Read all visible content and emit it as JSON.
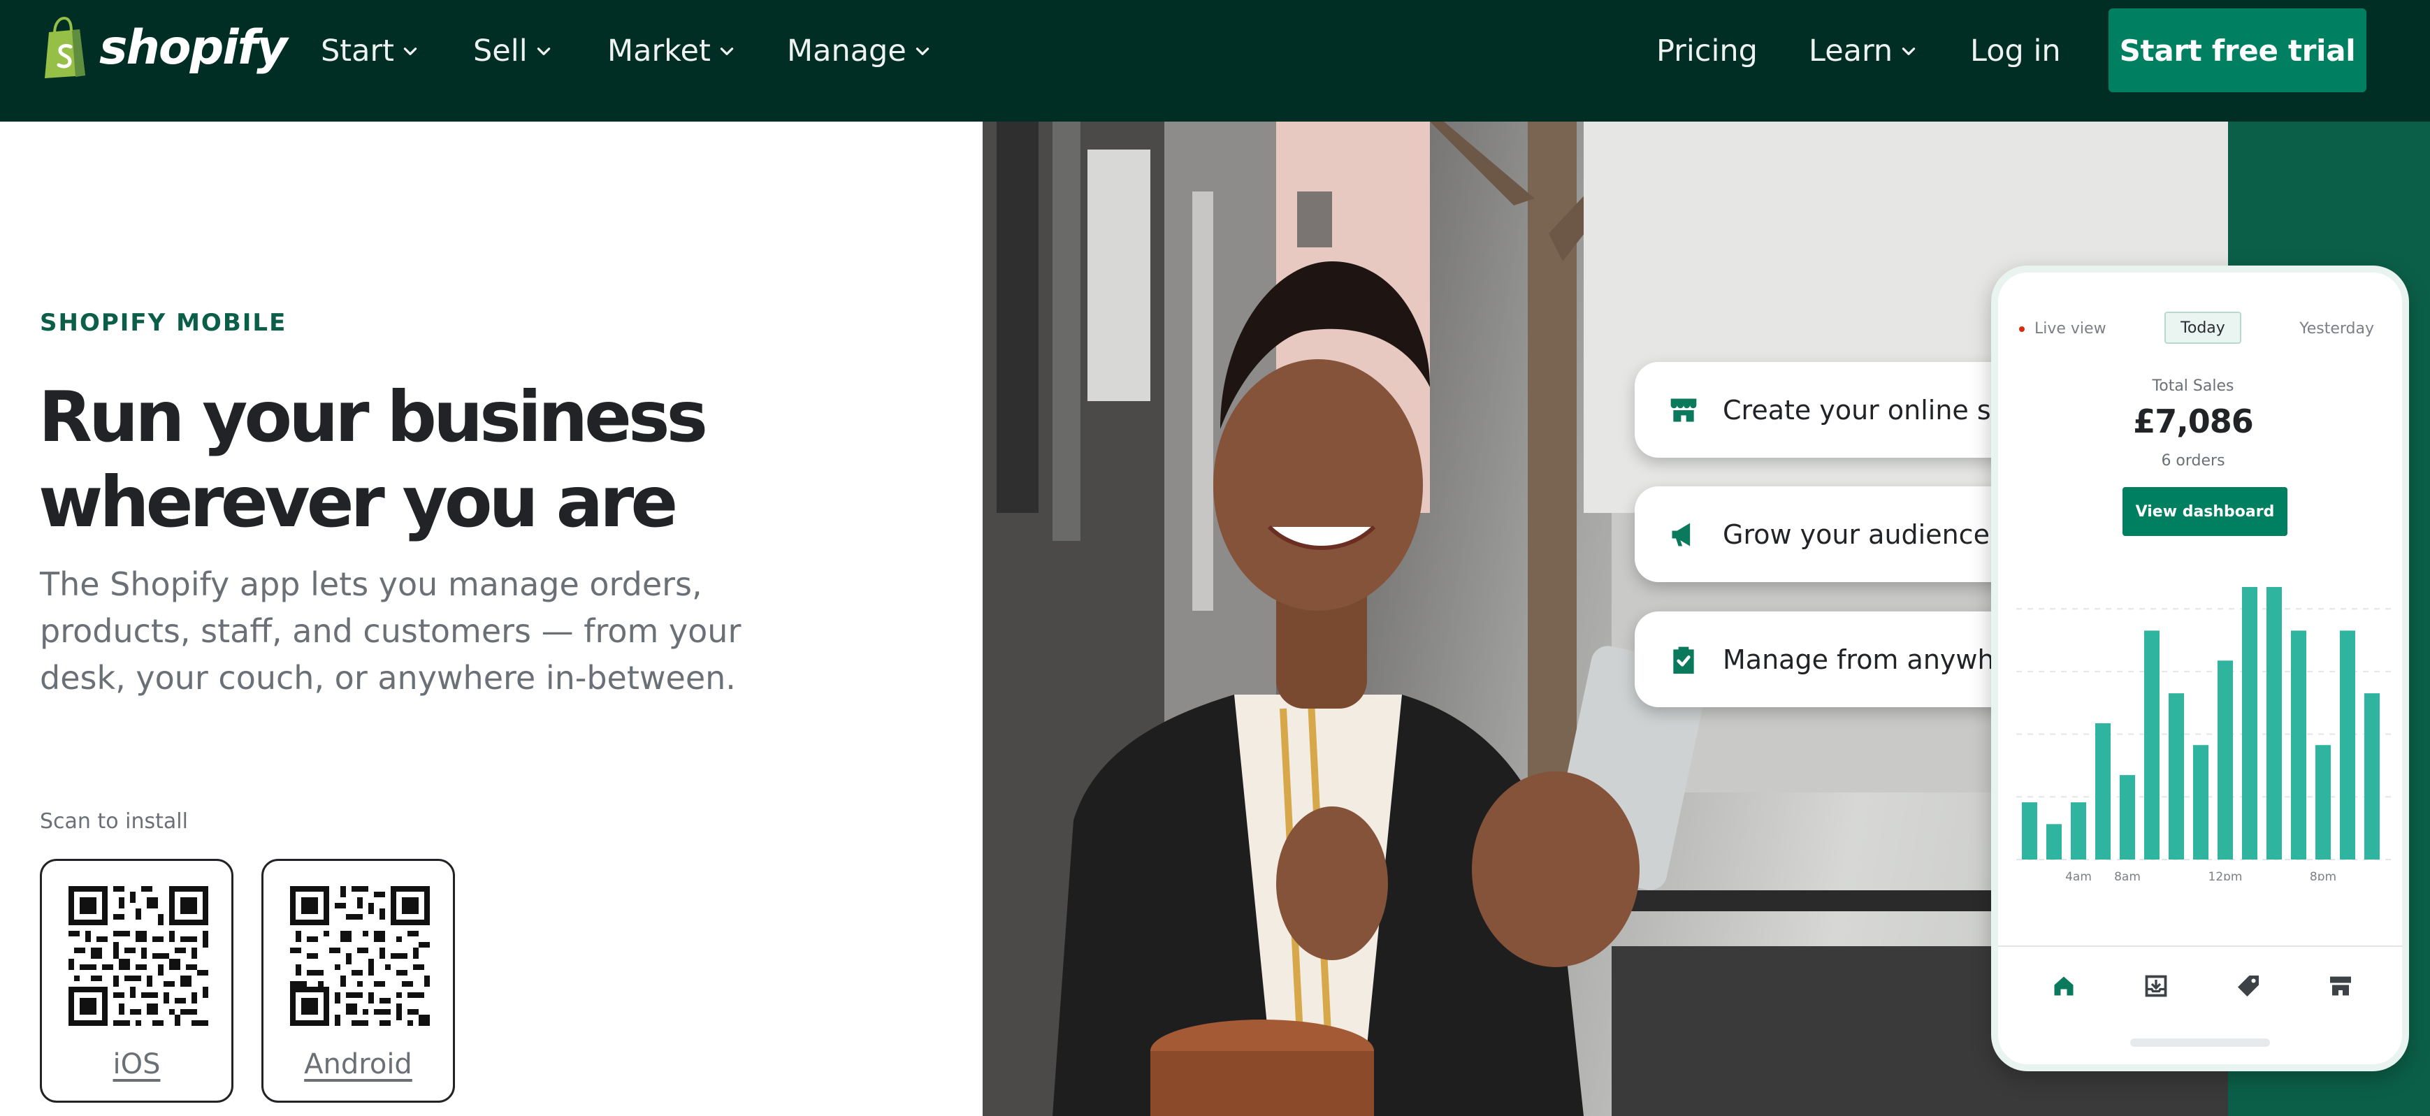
{
  "header": {
    "brand": "shopify",
    "nav": [
      {
        "label": "Start",
        "has_menu": true
      },
      {
        "label": "Sell",
        "has_menu": true
      },
      {
        "label": "Market",
        "has_menu": true
      },
      {
        "label": "Manage",
        "has_menu": true
      }
    ],
    "right_nav": [
      {
        "label": "Pricing",
        "has_menu": false
      },
      {
        "label": "Learn",
        "has_menu": true
      },
      {
        "label": "Log in",
        "has_menu": false
      }
    ],
    "cta_label": "Start free trial"
  },
  "hero": {
    "eyebrow": "SHOPIFY MOBILE",
    "title_line1": "Run your business",
    "title_line2": "wherever you are",
    "body": "The Shopify app lets you manage orders, products, staff, and customers — from your desk, your couch, or anywhere in-between.",
    "scan_label": "Scan to install",
    "qr_ios_label": "iOS",
    "qr_android_label": "Android"
  },
  "features": [
    {
      "label": "Create your online store",
      "icon": "storefront-icon"
    },
    {
      "label": "Grow your audience",
      "icon": "megaphone-icon"
    },
    {
      "label": "Manage from anywhere",
      "icon": "clipboard-check-icon"
    }
  ],
  "phone": {
    "tab_live": "Live view",
    "tab_today": "Today",
    "tab_yesterday": "Yesterday",
    "total_label": "Total Sales",
    "total_value": "£7,086",
    "orders": "6 orders",
    "button": "View dashboard",
    "chart_ticks": [
      "4am",
      "8am",
      "12pm",
      "8pm"
    ],
    "bar_levels": [
      0.21,
      0.13,
      0.21,
      0.5,
      0.31,
      0.84,
      0.61,
      0.42,
      0.73,
      1.0,
      1.0,
      0.84,
      0.42,
      0.84,
      0.61
    ],
    "bottom_nav": [
      "home-icon",
      "orders-icon",
      "tag-icon",
      "store-icon"
    ]
  },
  "colors": {
    "header_bg": "#002e25",
    "cta_green": "#008060",
    "panel_green": "#0b5f48",
    "bar_teal": "#2fb59f"
  }
}
